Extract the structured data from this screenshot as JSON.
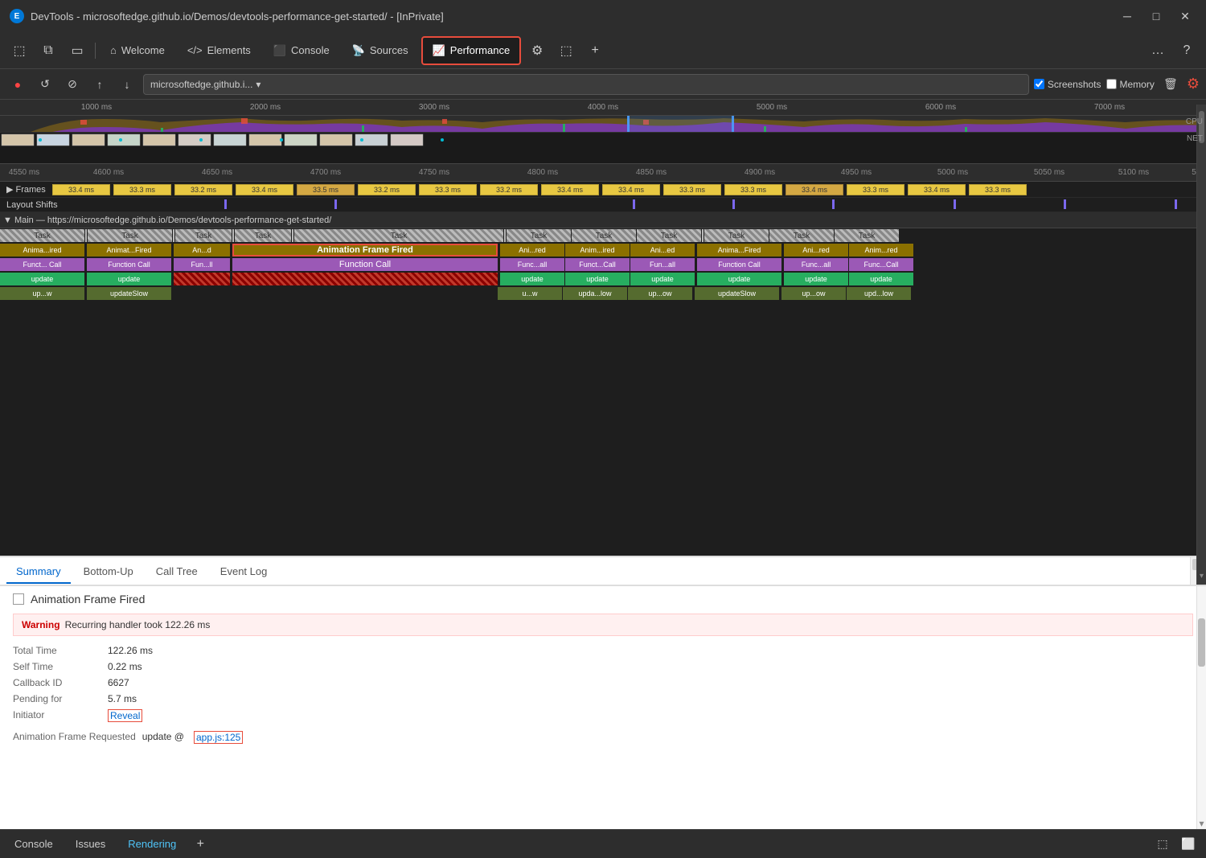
{
  "window": {
    "title": "DevTools - microsoftedge.github.io/Demos/devtools-performance-get-started/ - [InPrivate]"
  },
  "tabs": {
    "items": [
      {
        "id": "welcome",
        "label": "Welcome",
        "icon": "⌂",
        "active": false
      },
      {
        "id": "elements",
        "label": "Elements",
        "icon": "</>",
        "active": false
      },
      {
        "id": "console",
        "label": "Console",
        "icon": "⬛",
        "active": false
      },
      {
        "id": "sources",
        "label": "Sources",
        "icon": "📡",
        "active": false
      },
      {
        "id": "performance",
        "label": "Performance",
        "icon": "📈",
        "active": true
      },
      {
        "id": "settings",
        "label": "",
        "icon": "⚙",
        "active": false
      },
      {
        "id": "more",
        "label": "",
        "icon": "…",
        "active": false
      },
      {
        "id": "help",
        "label": "",
        "icon": "?",
        "active": false
      }
    ]
  },
  "toolbar": {
    "record_label": "●",
    "refresh_label": "↺",
    "clear_label": "⊘",
    "upload_label": "↑",
    "download_label": "↓",
    "url": "microsoftedge.github.i...",
    "screenshots_label": "Screenshots",
    "memory_label": "Memory",
    "trash_label": "🗑",
    "gear_label": "⚙"
  },
  "timeline_overview": {
    "ruler_ticks": [
      "1000 ms",
      "2000 ms",
      "3000 ms",
      "4000 ms",
      "5000 ms",
      "6000 ms",
      "7000 ms"
    ],
    "cpu_label": "CPU",
    "net_label": "NET"
  },
  "detail_ruler": {
    "ticks": [
      "4550 ms",
      "4600 ms",
      "4650 ms",
      "4700 ms",
      "4750 ms",
      "4800 ms",
      "4850 ms",
      "4900 ms",
      "4950 ms",
      "5000 ms",
      "5050 ms",
      "5100 ms",
      "5"
    ]
  },
  "frames_row": {
    "label": "▶ Frames",
    "blocks": [
      "33.4 ms",
      "33.3 ms",
      "33.2 ms",
      "33.4 ms",
      "33.5 ms",
      "33.2 ms",
      "33.3 ms",
      "33.2 ms",
      "33.4 ms",
      "33.4 ms",
      "33.3 ms",
      "33.3 ms",
      "33.4 ms",
      "33.3 ms",
      "33.4 ms",
      "33.3 ms"
    ]
  },
  "layout_shifts": {
    "label": "Layout Shifts"
  },
  "main_thread": {
    "label": "▼ Main — https://microsoftedge.github.io/Demos/devtools-performance-get-started/"
  },
  "flame_chart": {
    "task_row": [
      "Task",
      "Task",
      "Task",
      "Task",
      "Task",
      "Task",
      "Task",
      "Task",
      "Task",
      "Task"
    ],
    "row1": [
      {
        "label": "Anima...ired",
        "type": "olive"
      },
      {
        "label": "Animat...Fired",
        "type": "olive"
      },
      {
        "label": "An...d",
        "type": "olive"
      },
      {
        "label": "Animation Frame Fired",
        "type": "olive-selected"
      },
      {
        "label": "Ani...red",
        "type": "olive"
      },
      {
        "label": "Anim...ired",
        "type": "olive"
      },
      {
        "label": "Ani...ed",
        "type": "olive"
      },
      {
        "label": "Anima...Fired",
        "type": "olive"
      },
      {
        "label": "Ani...red",
        "type": "olive"
      },
      {
        "label": "Anim...red",
        "type": "olive"
      }
    ],
    "row2": [
      {
        "label": "Funct... Call",
        "type": "purple-light"
      },
      {
        "label": "Function Call",
        "type": "purple-light"
      },
      {
        "label": "Fun...ll",
        "type": "purple-light"
      },
      {
        "label": "Function Call",
        "type": "purple-light-selected"
      },
      {
        "label": "Func...all",
        "type": "purple-light"
      },
      {
        "label": "Funct...Call",
        "type": "purple-light"
      },
      {
        "label": "Fun...all",
        "type": "purple-light"
      },
      {
        "label": "Function Call",
        "type": "purple-light"
      },
      {
        "label": "Func...all",
        "type": "purple-light"
      },
      {
        "label": "Func...Call",
        "type": "purple-light"
      }
    ],
    "row3": [
      {
        "label": "update",
        "type": "green"
      },
      {
        "label": "update",
        "type": "green"
      },
      {
        "label": "",
        "type": "red-stripe"
      },
      {
        "label": "",
        "type": "red-stripe"
      },
      {
        "label": "update",
        "type": "green"
      },
      {
        "label": "update",
        "type": "green"
      },
      {
        "label": "update",
        "type": "green"
      },
      {
        "label": "update",
        "type": "green"
      },
      {
        "label": "update",
        "type": "green"
      },
      {
        "label": "update",
        "type": "green"
      }
    ],
    "row4": [
      {
        "label": "up...w",
        "type": "dark-olive"
      },
      {
        "label": "updateSlow",
        "type": "dark-olive"
      },
      {
        "label": "",
        "type": ""
      },
      {
        "label": "",
        "type": ""
      },
      {
        "label": "u...w",
        "type": "dark-olive"
      },
      {
        "label": "upda...low",
        "type": "dark-olive"
      },
      {
        "label": "up...ow",
        "type": "dark-olive"
      },
      {
        "label": "updateSlow",
        "type": "dark-olive"
      },
      {
        "label": "up...ow",
        "type": "dark-olive"
      },
      {
        "label": "upd...low",
        "type": "dark-olive"
      }
    ]
  },
  "bottom_tabs": {
    "items": [
      {
        "id": "summary",
        "label": "Summary",
        "active": true
      },
      {
        "id": "bottom-up",
        "label": "Bottom-Up",
        "active": false
      },
      {
        "id": "call-tree",
        "label": "Call Tree",
        "active": false
      },
      {
        "id": "event-log",
        "label": "Event Log",
        "active": false
      }
    ]
  },
  "summary": {
    "title": "Animation Frame Fired",
    "checkbox_label": "",
    "warning": {
      "label": "Warning",
      "text": "Recurring handler took 122.26 ms"
    },
    "rows": [
      {
        "key": "Total Time",
        "value": "122.26 ms"
      },
      {
        "key": "Self Time",
        "value": "0.22 ms"
      },
      {
        "key": "Callback ID",
        "value": "6627"
      },
      {
        "key": "Pending for",
        "value": "5.7 ms"
      },
      {
        "key": "Initiator",
        "value": "Reveal",
        "is_link": true
      },
      {
        "key": "Animation Frame Requested",
        "value": "update @ app.js:125",
        "is_code": true
      }
    ],
    "reveal_label": "Reveal",
    "code_ref": "app.js:125",
    "update_label": "update @"
  },
  "status_bar": {
    "tabs": [
      {
        "id": "console",
        "label": "Console",
        "active": false
      },
      {
        "id": "issues",
        "label": "Issues",
        "active": false
      },
      {
        "id": "rendering",
        "label": "Rendering",
        "active": true
      }
    ],
    "add_label": "+"
  },
  "colors": {
    "accent": "#0066cc",
    "record": "#f44336",
    "active_tab_border": "#e74c3c",
    "performance_tab_border": "#e74c3c"
  }
}
